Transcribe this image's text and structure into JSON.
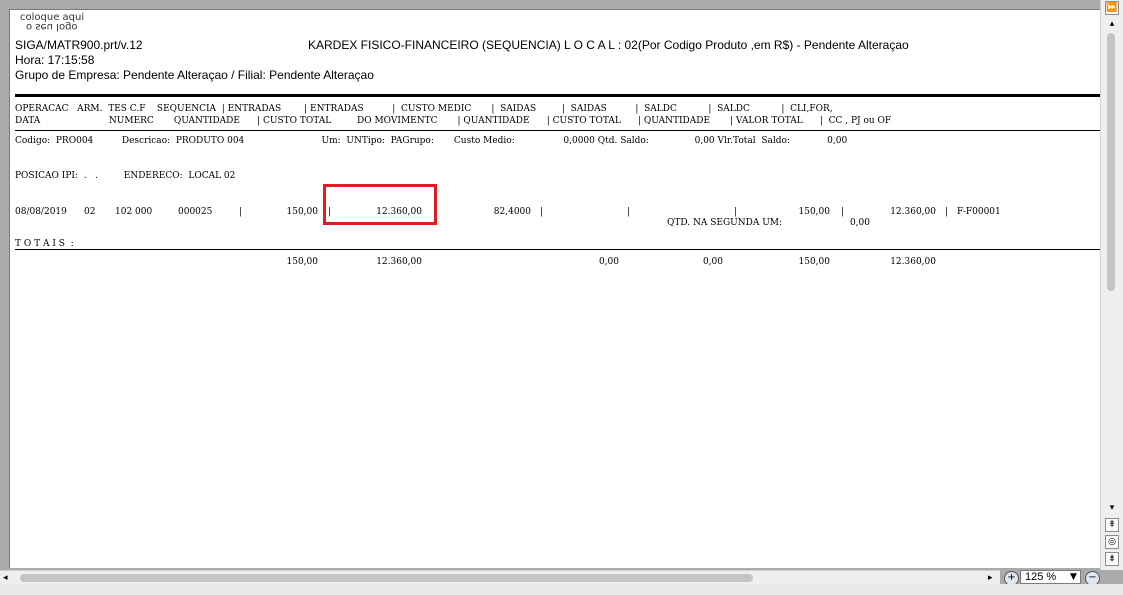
{
  "report": {
    "logo_line1": "coloque aqui",
    "logo_line2": "o seu logo",
    "program": "SIGA/MATR900.prt/v.12",
    "title": "KARDEX FISICO-FINANCEIRO (SEQUENCIA) L O C A L : 02(Por  Codigo Produto  ,em R$) - Pendente Alteraçao",
    "time": "Hora:  17:15:58",
    "group": "Grupo de Empresa: Pendente Alteraçao / Filial: Pendente Alteraçao",
    "header_line1": "OPERACAC   ARM.  TES C.F    SEQUENCIA  | ENTRADAS        | ENTRADAS          |  CUSTO MEDIC       |  SAIDAS         |  SAIDAS          |  SALDC           |  SALDC           |  CLI,FOR,",
    "header_line2": "DATA                        NUMERC       QUANTIDADE      | CUSTO TOTAL         DO MOVIMENTC       | QUANTIDADE      | CUSTO TOTAL      | QUANTIDADE       | VALOR TOTAL      |  CC , PJ ou OF",
    "product_line": "Codigo:  PRO004          Descricao:  PRODUTO 004                           Um:  UNTipo:  PAGrupo:       Custo Medio:                 0,0000 Qtd. Saldo:                0,00 Vlr.Total  Saldo:             0,00",
    "ipi_line": "POSICAO IPI:  .   .         ENDERECO:  LOCAL 02",
    "row": {
      "date": "08/08/2019",
      "arm": "02",
      "tes_cf": "102 000",
      "seq": "000025",
      "entradas_qtd": "150,00",
      "entradas_custo": "12.360,00",
      "custo_medio": "82,4000",
      "saldo_qtd": "150,00",
      "saldo_valor": "12.360,00",
      "cli_for": "F-F00001",
      "sep": "|"
    },
    "second_um_label": "QTD. NA SEGUNDA UM:",
    "second_um_value": "0,00",
    "totals_label": "T O T A I S  :",
    "totals": {
      "entradas_qtd": "150,00",
      "entradas_custo": "12.360,00",
      "saidas_qtd": "0,00",
      "saidas_custo": "0,00",
      "saldo_qtd": "150,00",
      "saldo_valor": "12.360,00"
    }
  },
  "viewer": {
    "zoom": "125 %",
    "highlight_color": "#e21b23",
    "next_page_icon": "fast-forward",
    "scroll_up_icon": "scroll-top",
    "center_icon": "circle",
    "scroll_down_icon": "scroll-bottom",
    "zoom_in_icon": "zoom-in",
    "zoom_out_icon": "zoom-out"
  }
}
